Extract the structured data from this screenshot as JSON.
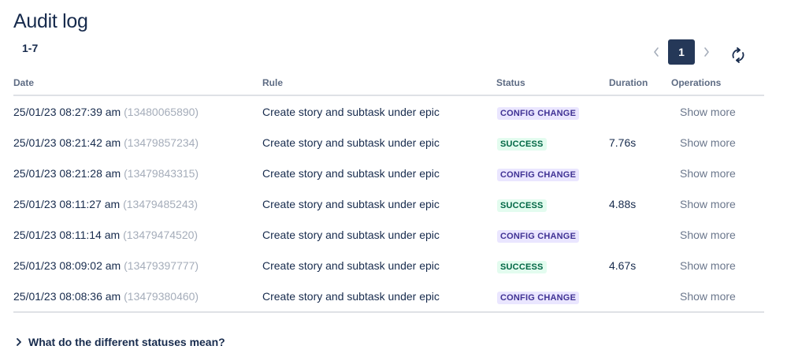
{
  "page": {
    "title": "Audit log",
    "range": "1-7"
  },
  "pagination": {
    "current_page": "1",
    "prev_icon": "chevron-left-icon",
    "next_icon": "chevron-right-icon",
    "refresh_icon": "refresh-icon"
  },
  "table": {
    "columns": [
      "Date",
      "Rule",
      "Status",
      "Duration",
      "Operations"
    ],
    "rows": [
      {
        "date": "25/01/23 08:27:39 am",
        "id": "(13480065890)",
        "rule": "Create story and subtask under epic",
        "status": "CONFIG CHANGE",
        "status_type": "config",
        "duration": "",
        "operation": "Show more"
      },
      {
        "date": "25/01/23 08:21:42 am",
        "id": "(13479857234)",
        "rule": "Create story and subtask under epic",
        "status": "SUCCESS",
        "status_type": "success",
        "duration": "7.76s",
        "operation": "Show more"
      },
      {
        "date": "25/01/23 08:21:28 am",
        "id": "(13479843315)",
        "rule": "Create story and subtask under epic",
        "status": "CONFIG CHANGE",
        "status_type": "config",
        "duration": "",
        "operation": "Show more"
      },
      {
        "date": "25/01/23 08:11:27 am",
        "id": "(13479485243)",
        "rule": "Create story and subtask under epic",
        "status": "SUCCESS",
        "status_type": "success",
        "duration": "4.88s",
        "operation": "Show more"
      },
      {
        "date": "25/01/23 08:11:14 am",
        "id": "(13479474520)",
        "rule": "Create story and subtask under epic",
        "status": "CONFIG CHANGE",
        "status_type": "config",
        "duration": "",
        "operation": "Show more"
      },
      {
        "date": "25/01/23 08:09:02 am",
        "id": "(13479397777)",
        "rule": "Create story and subtask under epic",
        "status": "SUCCESS",
        "status_type": "success",
        "duration": "4.67s",
        "operation": "Show more"
      },
      {
        "date": "25/01/23 08:08:36 am",
        "id": "(13479380460)",
        "rule": "Create story and subtask under epic",
        "status": "CONFIG CHANGE",
        "status_type": "config",
        "duration": "",
        "operation": "Show more"
      }
    ]
  },
  "faq": {
    "label": "What do the different statuses mean?",
    "icon": "chevron-right-icon"
  },
  "colors": {
    "text": "#172b4d",
    "muted": "#a5adba",
    "config_bg": "#eae6ff",
    "config_fg": "#403294",
    "success_bg": "#e3fcef",
    "success_fg": "#006644",
    "page_active": "#253858"
  }
}
